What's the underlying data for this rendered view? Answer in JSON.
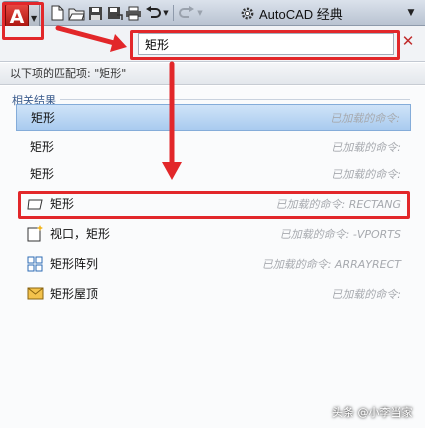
{
  "toolbar": {
    "workspace_label": "AutoCAD 经典"
  },
  "search": {
    "value": "矩形"
  },
  "results": {
    "header": "以下项的匹配项: \"矩形\"",
    "section_label": "相关结果",
    "items": [
      {
        "label": "矩形",
        "status": "已加载的命令:"
      },
      {
        "label": "矩形",
        "status": "已加载的命令:"
      },
      {
        "label": "矩形",
        "status": "已加载的命令:"
      },
      {
        "label": "矩形",
        "status": "已加载的命令: RECTANG"
      },
      {
        "label": "视口，矩形",
        "status": "已加载的命令: -VPORTS"
      },
      {
        "label": "矩形阵列",
        "status": "已加载的命令: ARRAYRECT"
      },
      {
        "label": "矩形屋顶",
        "status": "已加载的命令:"
      }
    ]
  },
  "watermark": "头条 @小李当家",
  "colors": {
    "highlight_red": "#e2272a",
    "selected_row": "#a9cbef",
    "status_gray": "#a6a9ae"
  }
}
